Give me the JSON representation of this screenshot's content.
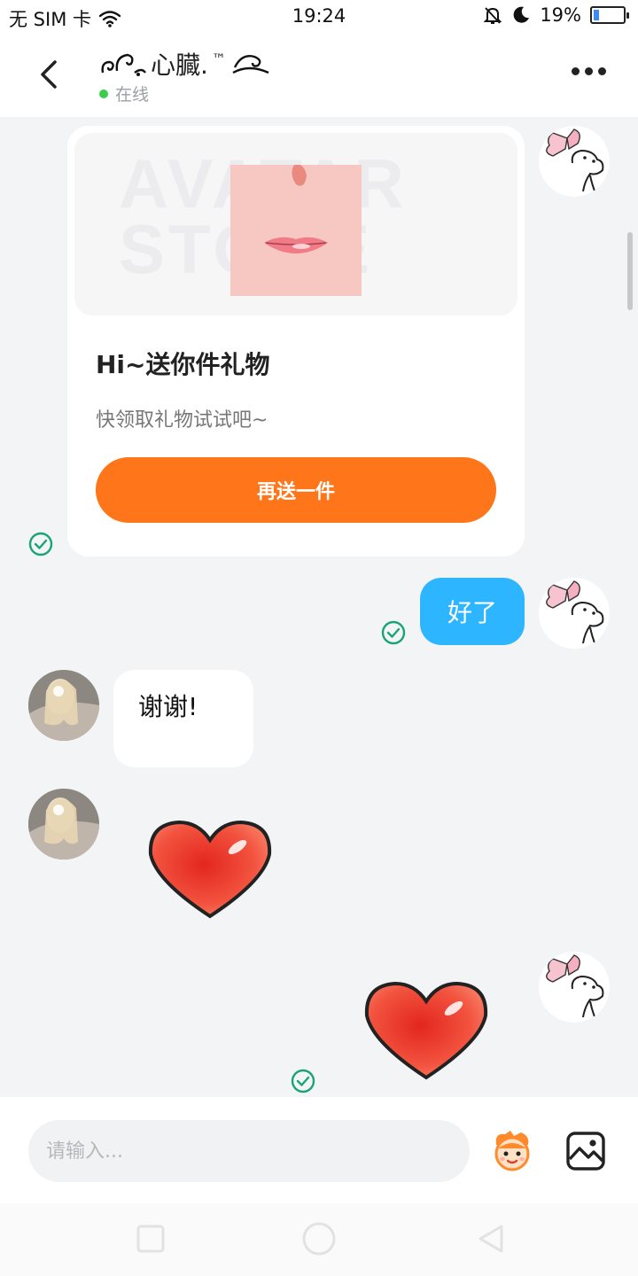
{
  "status_bar": {
    "carrier": "无 SIM 卡",
    "time": "19:24",
    "battery_percent": "19%",
    "battery_level": 0.19
  },
  "header": {
    "title": "心臓.",
    "trademark": "™",
    "status": "在线",
    "online_color": "#3ccc4c"
  },
  "gift_card": {
    "watermark": "AVATAR STORE",
    "title": "Hi~送你件礼物",
    "subtitle": "快领取礼物试试吧~",
    "button_label": "再送一件",
    "button_color": "#ff7519"
  },
  "messages": {
    "me_text": "好了",
    "other_text": "谢谢!"
  },
  "input": {
    "placeholder": "请输入..."
  },
  "colors": {
    "bubble_me": "#2db5ff",
    "tick": "#1aa37a"
  }
}
